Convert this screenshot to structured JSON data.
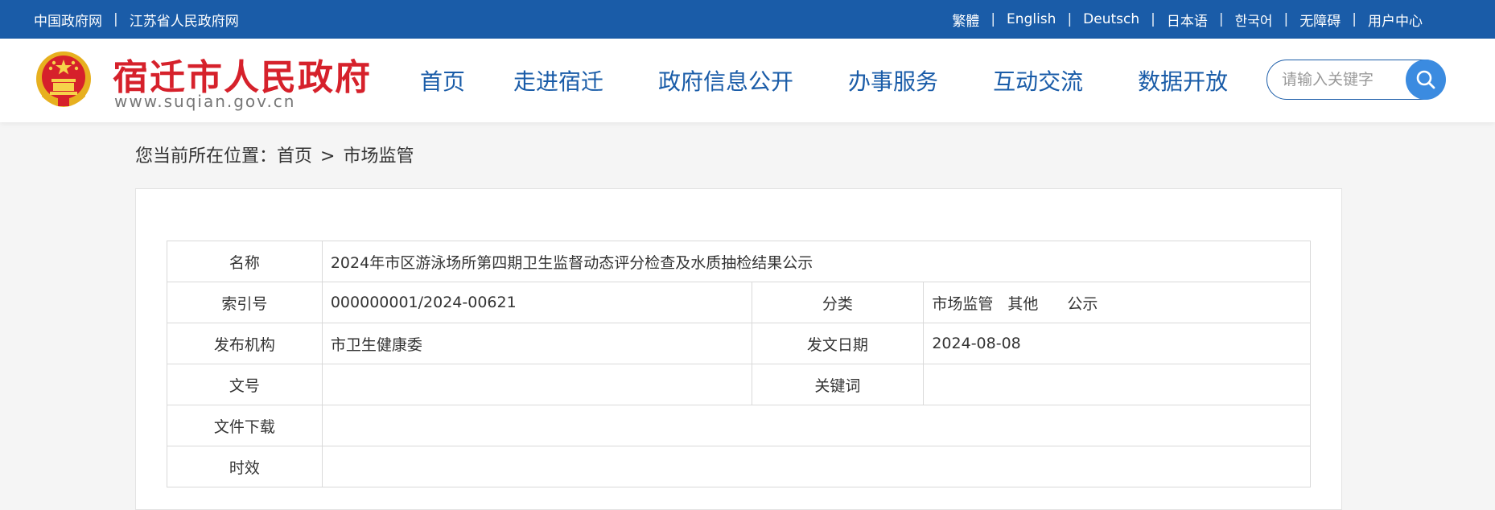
{
  "topbar": {
    "left_links": [
      "中国政府网",
      "江苏省人民政府网"
    ],
    "right_links": [
      "繁體",
      "English",
      "Deutsch",
      "日本语",
      "한국어",
      "无障碍",
      "用户中心"
    ],
    "separator": "|"
  },
  "header": {
    "site_title": "宿迁市人民政府",
    "site_url": "www.suqian.gov.cn",
    "emblem_icon": "national-emblem-icon",
    "nav": [
      "首页",
      "走进宿迁",
      "政府信息公开",
      "办事服务",
      "互动交流",
      "数据开放"
    ],
    "search": {
      "placeholder": "请输入关键字",
      "value": "",
      "icon": "search-icon"
    }
  },
  "breadcrumb": {
    "prefix": "您当前所在位置：",
    "items": [
      "首页",
      "市场监管"
    ],
    "separator": ">"
  },
  "info_table": {
    "name_label": "名称",
    "name_value": "2024年市区游泳场所第四期卫生监督动态评分检查及水质抽检结果公示",
    "index_label": "索引号",
    "index_value": "000000001/2024-00621",
    "category_label": "分类",
    "category_values": [
      "市场监管",
      "其他",
      "公示"
    ],
    "publisher_label": "发布机构",
    "publisher_value": "市卫生健康委",
    "date_label": "发文日期",
    "date_value": "2024-08-08",
    "doc_no_label": "文号",
    "doc_no_value": "",
    "keyword_label": "关键词",
    "keyword_value": "",
    "download_label": "文件下载",
    "download_value": "",
    "validity_label": "时效",
    "validity_value": ""
  },
  "colors": {
    "topbar_bg": "#1a5ca8",
    "nav_text": "#1a5ca8",
    "title_red": "#d6212b",
    "search_button": "#3b8be0"
  }
}
